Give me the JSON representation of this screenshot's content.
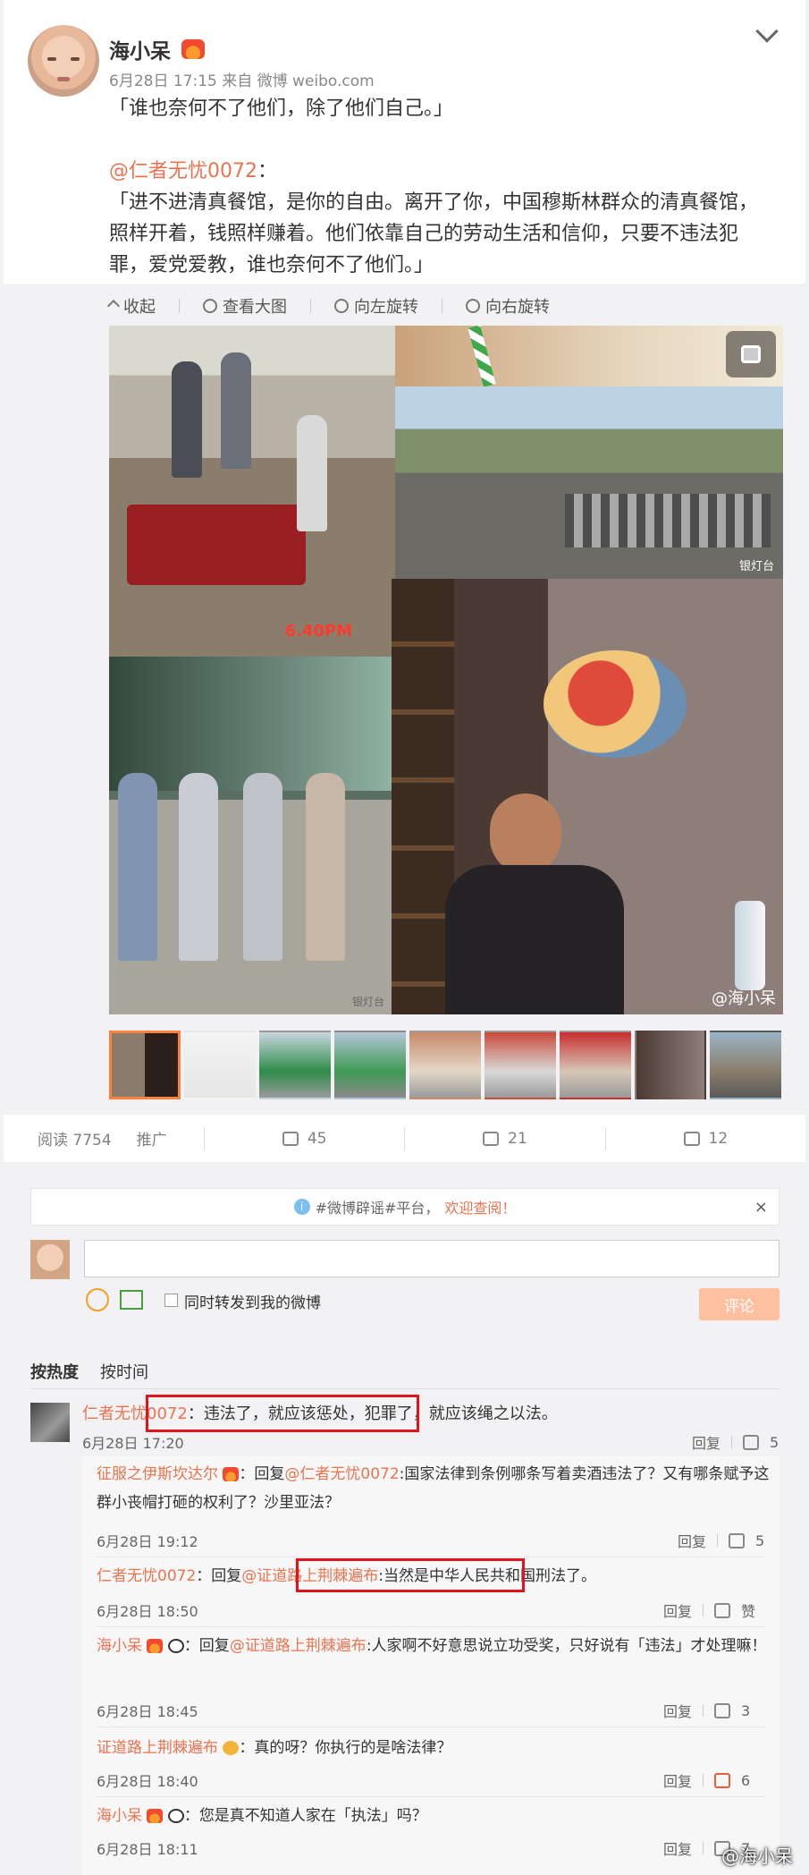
{
  "post": {
    "author": "海小呆",
    "meta": "6月28日 17:15 来自 微博 weibo.com",
    "quote": "「谁也奈何不了他们，除了他们自己。」",
    "mention": "@仁者无忧0072",
    "mention_suffix": "：",
    "body": "「进不进清真餐馆，是你的自由。离开了你，中国穆斯林群众的清真餐馆，照样开着，钱照样赚着。他们依靠自己的劳动生活和信仰，只要不违法犯罪，爱党爱教，谁也奈何不了他们。」"
  },
  "viewer": {
    "tools": [
      "收起",
      "查看大图",
      "向左旋转",
      "向右旋转"
    ],
    "stamp": "6.40PM",
    "wm_small": "银灯台",
    "wm_main": "@海小呆",
    "thumb_count": 9
  },
  "stats": {
    "reads_label": "阅读 7754",
    "promote": "推广",
    "shares": "45",
    "comments": "21",
    "likes": "12"
  },
  "comment_box": {
    "notice_prefix": "#微博辟谣#平台，",
    "notice_link": "欢迎查阅！",
    "notice_close": "×",
    "repost_label": "同时转发到我的微博",
    "submit_label": "评论"
  },
  "sort": {
    "hot": "按热度",
    "time": "按时间"
  },
  "top_comment": {
    "name": "仁者无忧0072",
    "sep": "：",
    "text": "违法了，就应该惩处，犯罪了，就应该绳之以法。",
    "time": "6月28日 17:20",
    "reply": "回复",
    "likes": "5"
  },
  "replies": [
    {
      "name": "征服之伊斯坎达尔",
      "text_prefix": "：回复",
      "target": "@仁者无忧0072",
      "text": ":国家法律到条例哪条写着卖酒违法了？又有哪条赋予这群小丧帽打砸的权利了？沙里亚法？",
      "time": "6月28日 19:12",
      "reply": "回复",
      "likes": "5"
    },
    {
      "name": "仁者无忧0072",
      "text_prefix": "：回复",
      "target": "@证道路上荆棘遍布",
      "text": ":当然是中华人民共和国刑法了。",
      "time": "6月28日 18:50",
      "reply": "回复",
      "likes": "赞"
    },
    {
      "name": "海小呆",
      "text_prefix": "：回复",
      "target": "@证道路上荆棘遍布",
      "text": ":人家啊不好意思说立功受奖，只好说有「违法」才处理嘛！",
      "time": "6月28日 18:45",
      "reply": "回复",
      "likes": "3"
    },
    {
      "name": "证道路上荆棘遍布",
      "text_prefix": "：",
      "target": "",
      "text": "真的呀？你执行的是啥法律？",
      "time": "6月28日 18:40",
      "reply": "回复",
      "likes": "6"
    },
    {
      "name": "海小呆",
      "text_prefix": "：",
      "target": "",
      "text": "您是真不知道人家在「执法」吗？",
      "time": "6月28日 18:11",
      "reply": "回复",
      "likes": "7"
    }
  ],
  "footer_wm": "@海小呆",
  "colors": {
    "accent": "#eb7350",
    "highlight_box": "#e0141a",
    "submit_bg": "#ffc09f"
  }
}
